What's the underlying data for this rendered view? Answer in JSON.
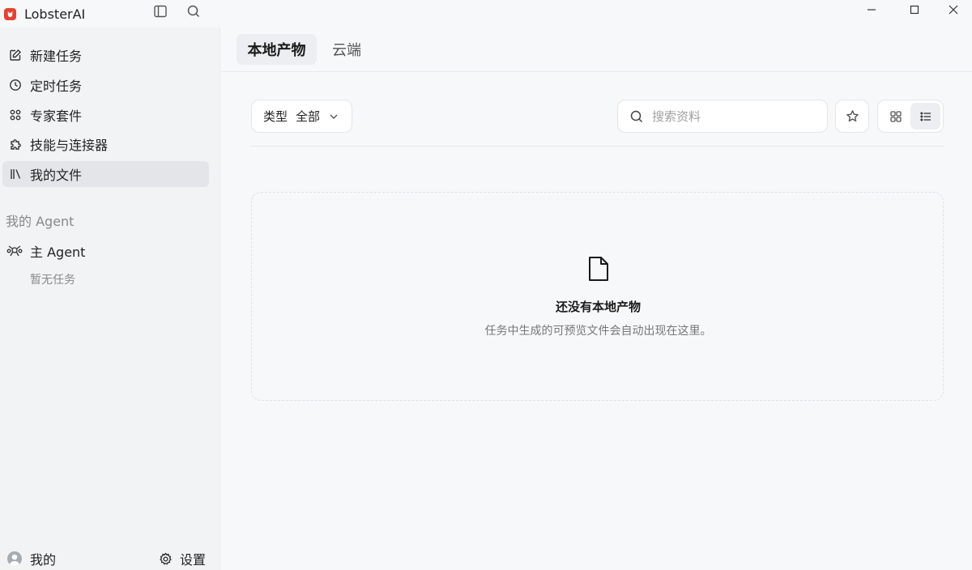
{
  "app": {
    "title": "LobsterAI"
  },
  "sidebar": {
    "items": [
      {
        "label": "新建任务",
        "icon": "edit-icon"
      },
      {
        "label": "定时任务",
        "icon": "clock-icon"
      },
      {
        "label": "专家套件",
        "icon": "grid-dots-icon"
      },
      {
        "label": "技能与连接器",
        "icon": "puzzle-icon"
      },
      {
        "label": "我的文件",
        "icon": "library-icon",
        "active": true
      }
    ],
    "agent_section": {
      "title": "我的 Agent",
      "agents": [
        {
          "label": "主 Agent",
          "empty_text": "暂无任务"
        }
      ]
    },
    "footer": {
      "user_label": "我的",
      "settings_label": "设置"
    }
  },
  "main": {
    "tabs": [
      {
        "label": "本地产物",
        "active": true
      },
      {
        "label": "云端",
        "active": false
      }
    ],
    "filter": {
      "type_label": "类型",
      "value": "全部"
    },
    "search": {
      "placeholder": "搜索资料"
    },
    "empty_state": {
      "title": "还没有本地产物",
      "description": "任务中生成的可预览文件会自动出现在这里。"
    }
  },
  "colors": {
    "brand": "#e8402f",
    "active_bg": "#e4e5e8"
  }
}
